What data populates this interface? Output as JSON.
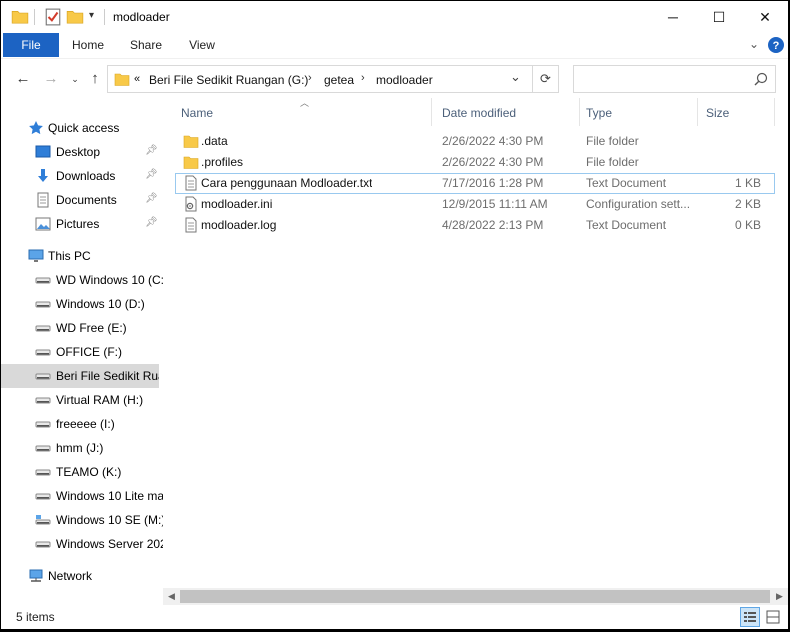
{
  "window": {
    "title": "modloader",
    "controls": {
      "minimize": "─",
      "maximize": "☐",
      "close": "✕"
    }
  },
  "ribbon": {
    "tabs": [
      "File",
      "Home",
      "Share",
      "View"
    ],
    "expand_icon": "chevron-down-icon",
    "help_icon": "help-icon"
  },
  "address": {
    "overflow": "«",
    "crumbs": [
      "Beri File Sedikit Ruangan (G:)",
      "getea",
      "modloader"
    ],
    "separator": "›",
    "dropdown": "⌄",
    "refresh": "⟳",
    "search_placeholder": "",
    "search_icon": "search-icon"
  },
  "navpane": {
    "quick_access": {
      "label": "Quick access",
      "items": [
        "Desktop",
        "Downloads",
        "Documents",
        "Pictures"
      ]
    },
    "this_pc": {
      "label": "This PC",
      "drives": [
        "WD Windows 10 (C:",
        "Windows 10 (D:)",
        "WD Free (E:)",
        "OFFICE (F:)",
        "Beri File Sedikit Ruangan (G:)",
        "Virtual RAM (H:)",
        "freeeee (I:)",
        "hmm (J:)",
        "TEAMO (K:)",
        "Windows 10 Lite ma",
        "Windows 10 SE (M:)",
        "Windows Server 202"
      ]
    },
    "network": {
      "label": "Network"
    }
  },
  "columns": {
    "name": "Name",
    "date": "Date modified",
    "type": "Type",
    "size": "Size"
  },
  "files": [
    {
      "name": ".data",
      "date": "2/26/2022 4:30 PM",
      "type": "File folder",
      "size": "",
      "icon": "folder-icon"
    },
    {
      "name": ".profiles",
      "date": "2/26/2022 4:30 PM",
      "type": "File folder",
      "size": "",
      "icon": "folder-icon"
    },
    {
      "name": "Cara penggunaan Modloader.txt",
      "date": "7/17/2016 1:28 PM",
      "type": "Text Document",
      "size": "1 KB",
      "icon": "text-file-icon"
    },
    {
      "name": "modloader.ini",
      "date": "12/9/2015 11:11 AM",
      "type": "Configuration sett...",
      "size": "2 KB",
      "icon": "config-file-icon"
    },
    {
      "name": "modloader.log",
      "date": "4/28/2022 2:13 PM",
      "type": "Text Document",
      "size": "0 KB",
      "icon": "text-file-icon"
    }
  ],
  "status": {
    "item_count": "5 items"
  },
  "colors": {
    "accent": "#1c63c3",
    "selection": "#d9d9d9",
    "focus_border": "#99c9ef",
    "folder": "#f8c948"
  }
}
